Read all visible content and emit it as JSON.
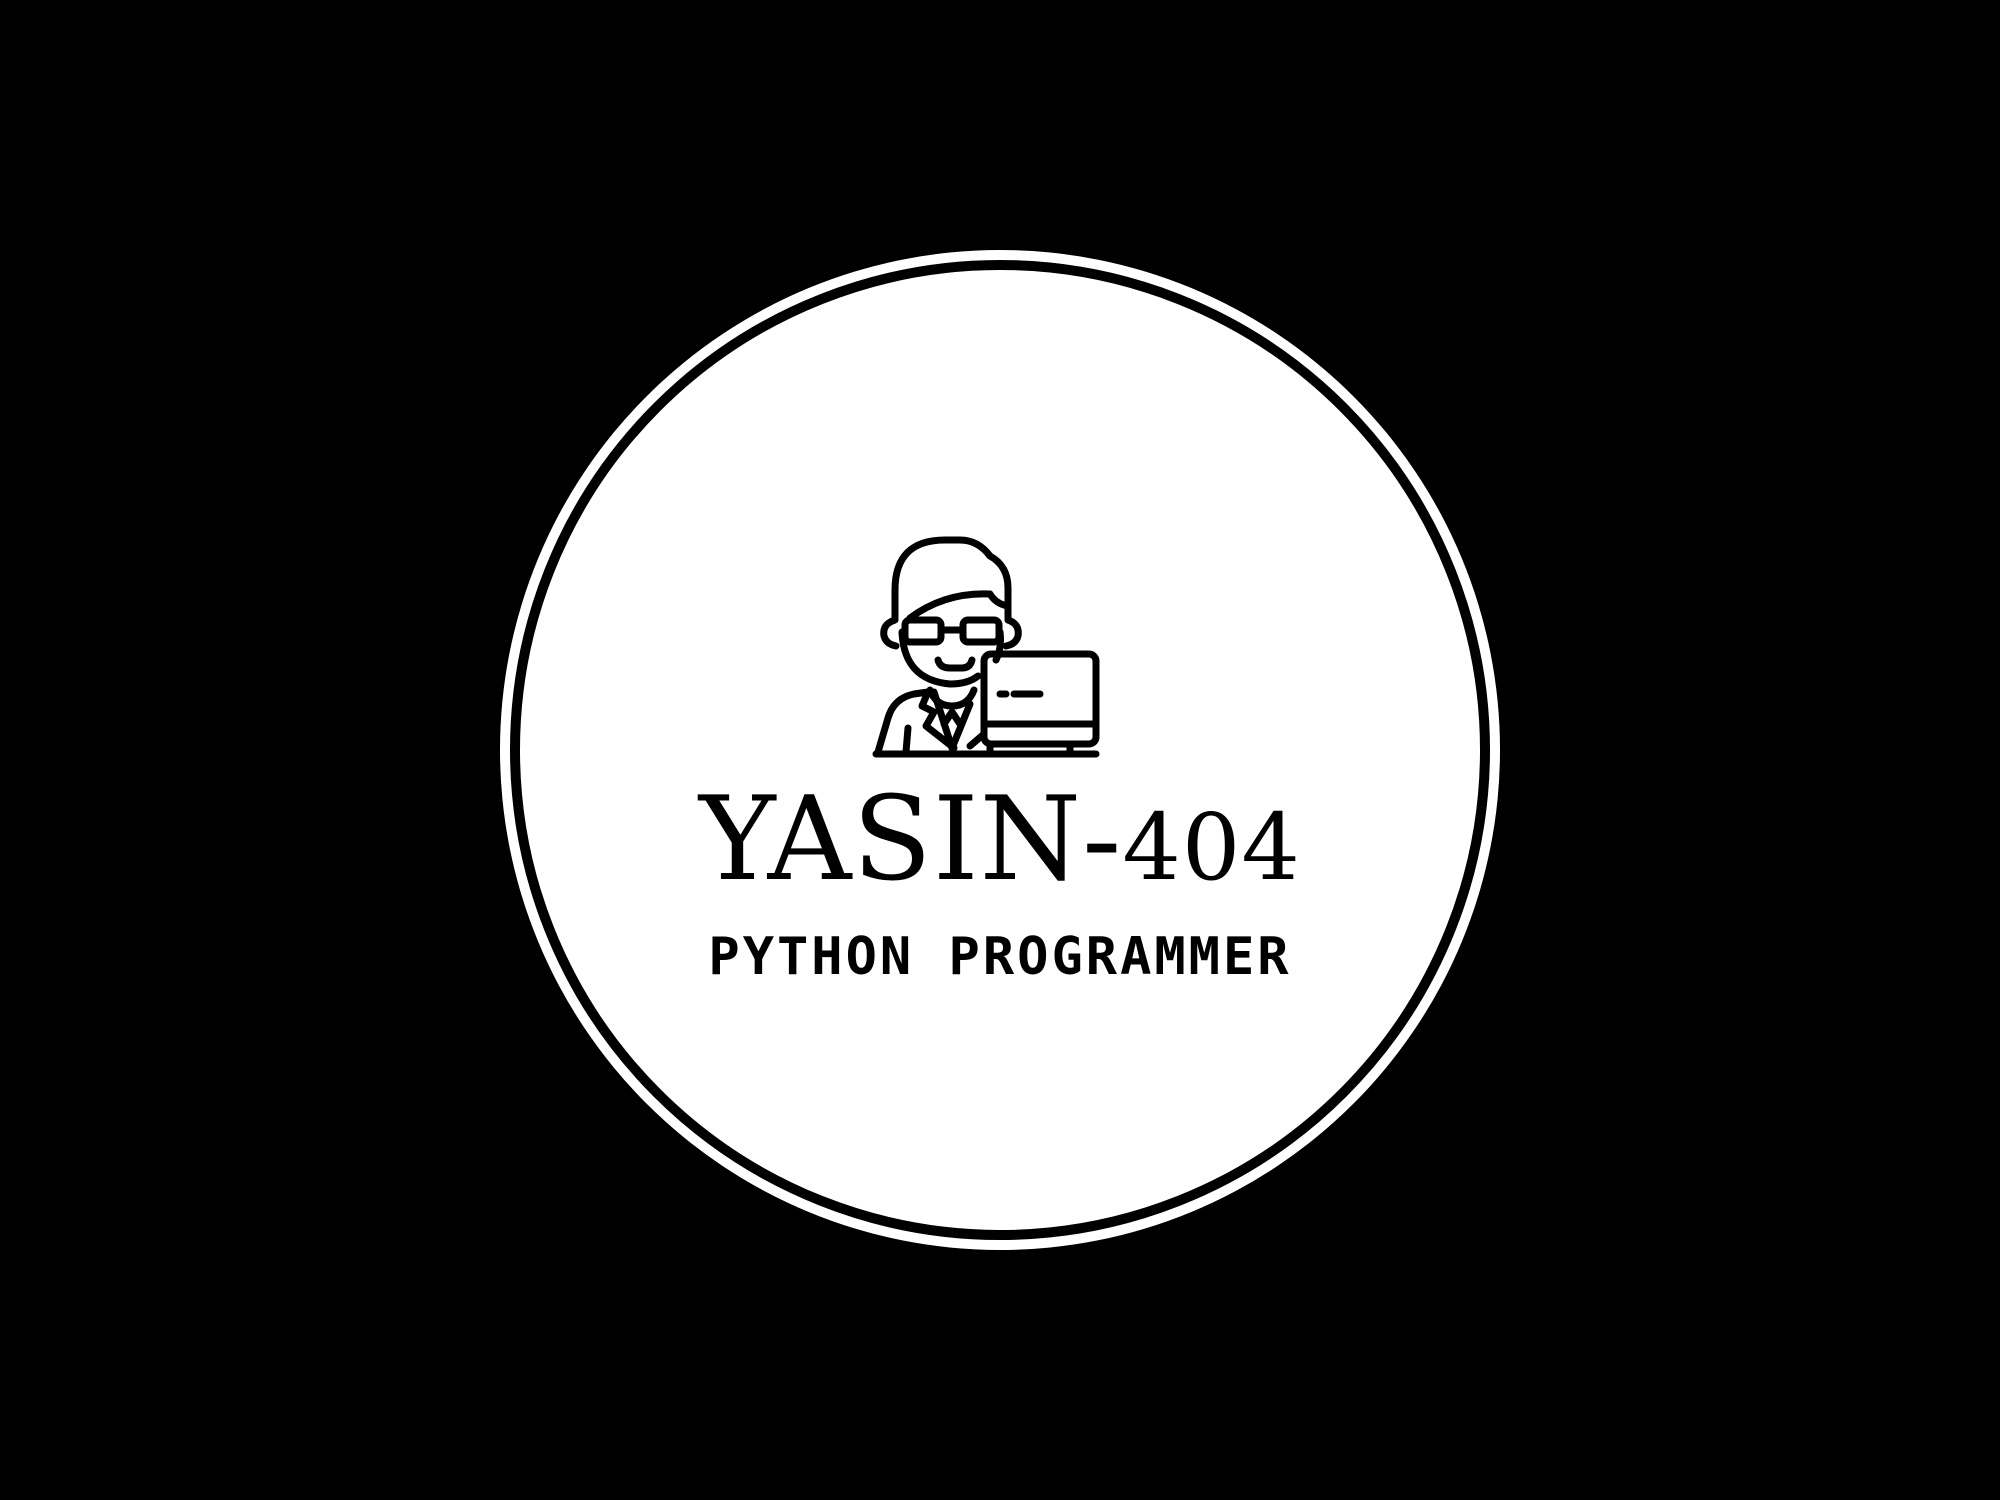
{
  "logo": {
    "name_main": "YASIN-",
    "name_number": "404",
    "tagline": "PYTHON PROGRAMMER",
    "icon": "programmer-at-laptop-icon"
  },
  "colors": {
    "background": "#000000",
    "badge": "#ffffff",
    "ink": "#000000"
  }
}
